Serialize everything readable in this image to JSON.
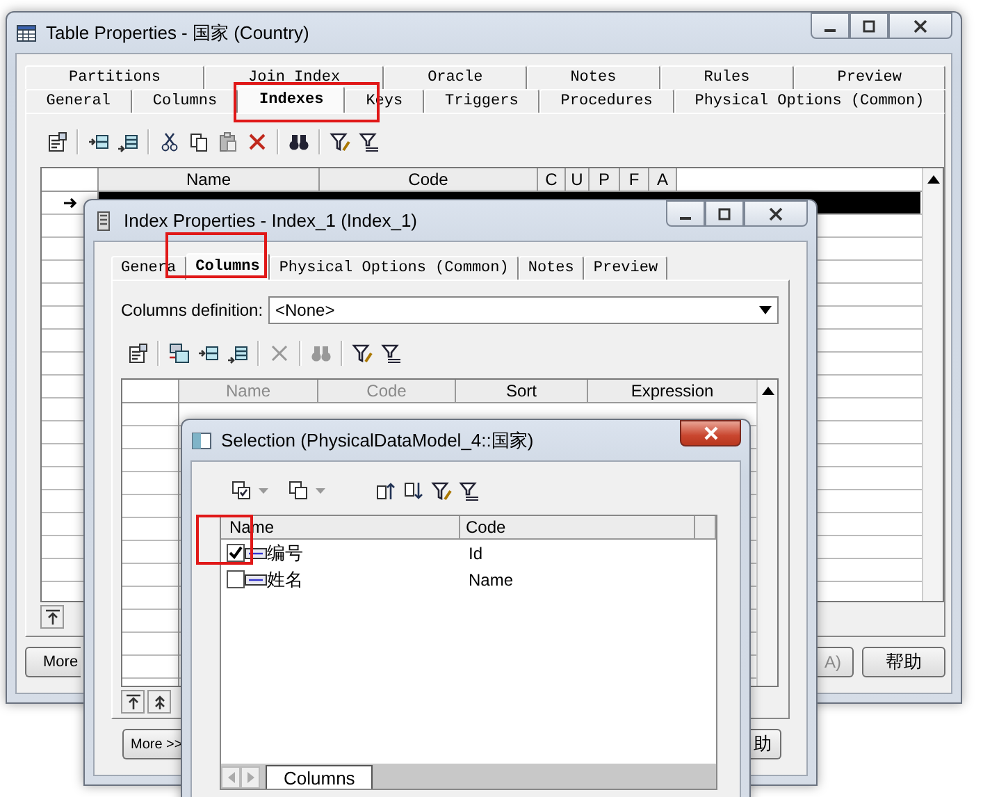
{
  "table_properties": {
    "title": "Table Properties - 国家 (Country)",
    "tab_rows": [
      [
        {
          "label": "Partitions",
          "selected": false
        },
        {
          "label": "Join Index",
          "selected": false
        },
        {
          "label": "Oracle",
          "selected": false
        },
        {
          "label": "Notes",
          "selected": false
        },
        {
          "label": "Rules",
          "selected": false
        },
        {
          "label": "Preview",
          "selected": false
        }
      ],
      [
        {
          "label": "General",
          "selected": false
        },
        {
          "label": "Columns",
          "selected": false
        },
        {
          "label": "Indexes",
          "selected": true
        },
        {
          "label": "Keys",
          "selected": false
        },
        {
          "label": "Triggers",
          "selected": false
        },
        {
          "label": "Procedures",
          "selected": false
        },
        {
          "label": "Physical Options (Common)",
          "selected": false
        }
      ]
    ],
    "grid": {
      "columns": [
        "Name",
        "Code",
        "C",
        "U",
        "P",
        "F",
        "A"
      ],
      "rows": [
        {
          "selected": true
        }
      ]
    },
    "buttons": [
      "More",
      "A)",
      "帮助"
    ]
  },
  "index_properties": {
    "title": "Index Properties - Index_1 (Index_1)",
    "tabs": [
      {
        "label": "Genera",
        "selected": false
      },
      {
        "label": "Columns",
        "selected": true
      },
      {
        "label": "Physical Options (Common)",
        "selected": false
      },
      {
        "label": "Notes",
        "selected": false
      },
      {
        "label": "Preview",
        "selected": false
      }
    ],
    "columns_definition": {
      "label": "Columns definition:",
      "value": "<None>"
    },
    "grid": {
      "columns": [
        {
          "label": "Name",
          "disabled": true
        },
        {
          "label": "Code",
          "disabled": true
        },
        {
          "label": "Sort",
          "disabled": false
        },
        {
          "label": "Expression",
          "disabled": false
        }
      ]
    },
    "buttons": [
      "More >>",
      "助"
    ]
  },
  "selection": {
    "title": "Selection (PhysicalDataModel_4::国家)",
    "columns": [
      "Name",
      "Code"
    ],
    "rows": [
      {
        "name": "编号",
        "code": "Id",
        "checked": true
      },
      {
        "name": "姓名",
        "code": "Name",
        "checked": false
      }
    ],
    "tabs": [
      {
        "label": "Columns",
        "selected": true
      }
    ]
  }
}
